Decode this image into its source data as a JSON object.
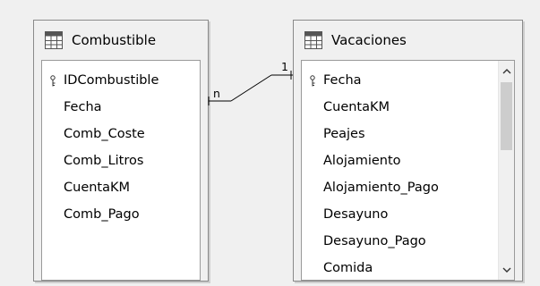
{
  "tables": {
    "combustible": {
      "title": "Combustible",
      "fields": [
        {
          "name": "IDCombustible",
          "primary_key": true
        },
        {
          "name": "Fecha",
          "primary_key": false
        },
        {
          "name": "Comb_Coste",
          "primary_key": false
        },
        {
          "name": "Comb_Litros",
          "primary_key": false
        },
        {
          "name": "CuentaKM",
          "primary_key": false
        },
        {
          "name": "Comb_Pago",
          "primary_key": false
        }
      ]
    },
    "vacaciones": {
      "title": "Vacaciones",
      "fields": [
        {
          "name": "Fecha",
          "primary_key": true
        },
        {
          "name": "CuentaKM",
          "primary_key": false
        },
        {
          "name": "Peajes",
          "primary_key": false
        },
        {
          "name": "Alojamiento",
          "primary_key": false
        },
        {
          "name": "Alojamiento_Pago",
          "primary_key": false
        },
        {
          "name": "Desayuno",
          "primary_key": false
        },
        {
          "name": "Desayuno_Pago",
          "primary_key": false
        },
        {
          "name": "Comida",
          "primary_key": false
        }
      ]
    }
  },
  "relationship": {
    "from_table": "Combustible",
    "from_field": "Fecha",
    "from_cardinality": "n",
    "to_table": "Vacaciones",
    "to_field": "Fecha",
    "to_cardinality": "1"
  },
  "icons": {
    "table": "table-grid-icon",
    "primary_key": "key-icon",
    "scroll_up": "chevron-up-icon",
    "scroll_down": "chevron-down-icon"
  }
}
